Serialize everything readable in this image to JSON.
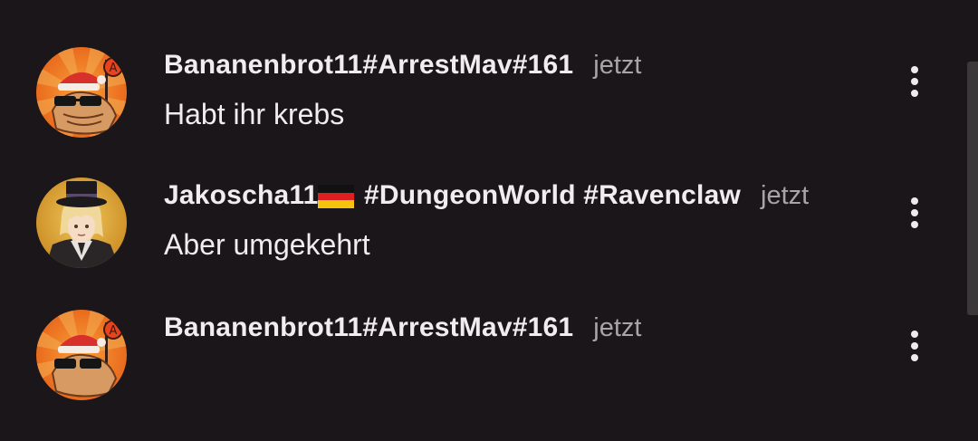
{
  "comments": [
    {
      "author": "Bananenbrot11#ArrestMav#161",
      "author_suffix": "",
      "time": "jetzt",
      "text": "Habt ihr krebs",
      "avatar": "orange-sunburst-santa-hat-cat-avatar"
    },
    {
      "author": "Jakoscha11",
      "author_flag": "german-flag-emoji",
      "author_suffix": " #DungeonWorld #Ravenclaw",
      "time": "jetzt",
      "text": "Aber umgekehrt",
      "avatar": "top-hat-anime-character-avatar"
    },
    {
      "author": "Bananenbrot11#ArrestMav#161",
      "author_suffix": "",
      "time": "jetzt",
      "text": "",
      "avatar": "orange-sunburst-santa-hat-cat-avatar"
    }
  ],
  "icons": {
    "more": "more-vertical-icon"
  },
  "colors": {
    "background": "#1a1619",
    "primary_text": "#f1ecef",
    "secondary_text": "#aaa3a8",
    "avatar_orange": "#f07a1e"
  }
}
